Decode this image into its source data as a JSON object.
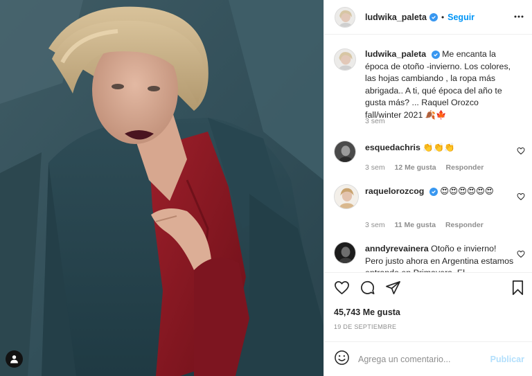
{
  "post": {
    "photo_alt_icon": "user-tag-icon"
  },
  "header": {
    "username": "ludwika_paleta",
    "separator": "•",
    "follow_label": "Seguir",
    "more_icon": "more-options-icon"
  },
  "caption": {
    "username": "ludwika_paleta",
    "text": "Me encanta la época de otoño -invierno. Los colores, las hojas cambiando , la ropa más abrigada.. A ti, qué época del año te gusta más? ... Raquel Orozco fall/winter 2021",
    "emojis": "🍂🍁",
    "time": "3 sem"
  },
  "comments": [
    {
      "username": "esquedachris",
      "verified": false,
      "text": "👏👏👏",
      "time": "3 sem",
      "likes": "12 Me gusta",
      "reply": "Responder"
    },
    {
      "username": "raquelorozcog",
      "verified": true,
      "text": "😍😍😍😍😍😍",
      "time": "3 sem",
      "likes": "11 Me gusta",
      "reply": "Responder"
    },
    {
      "username": "anndyrevainera",
      "verified": false,
      "text": "Otoño e invierno! Pero justo ahora en Argentina estamos entrando en Primavera. El"
    }
  ],
  "actions": {
    "like_icon": "heart-icon",
    "comment_icon": "comment-icon",
    "share_icon": "share-icon",
    "save_icon": "bookmark-icon"
  },
  "likes_count": "45,743 Me gusta",
  "date": "19 DE SEPTIEMBRE",
  "add_comment": {
    "placeholder": "Agrega un comentario...",
    "publish_label": "Publicar",
    "emoji_icon": "emoji-icon"
  },
  "colors": {
    "accent": "#0095f6",
    "verified": "#3897f0",
    "publish_disabled": "#b2dffc"
  }
}
